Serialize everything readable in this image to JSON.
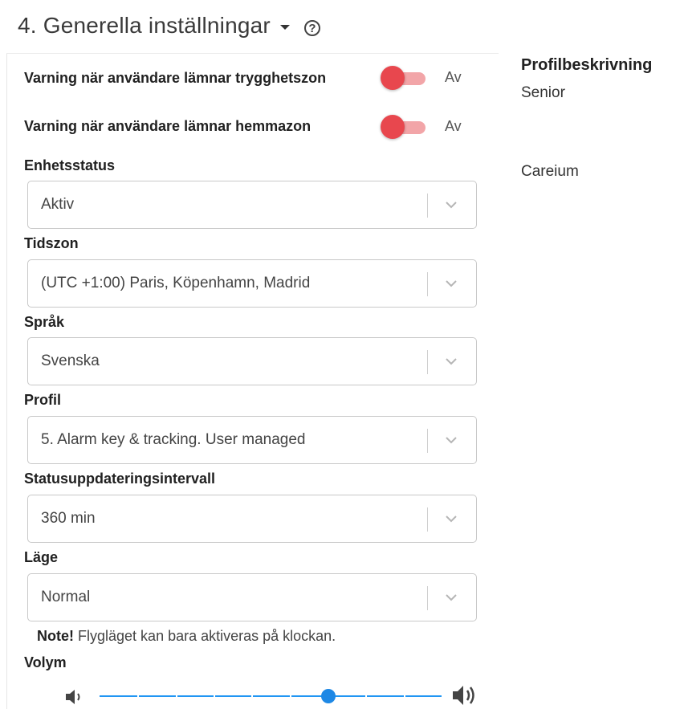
{
  "header": {
    "title": "4. Generella inställningar",
    "help_glyph": "?"
  },
  "toggles": [
    {
      "label": "Varning när användare lämnar trygghetszon",
      "state": "Av",
      "on": false
    },
    {
      "label": "Varning när användare lämnar hemmazon",
      "state": "Av",
      "on": false
    }
  ],
  "fields": {
    "device_status": {
      "label": "Enhetsstatus",
      "value": "Aktiv"
    },
    "timezone": {
      "label": "Tidszon",
      "value": "(UTC +1:00) Paris, Köpenhamn, Madrid"
    },
    "language": {
      "label": "Språk",
      "value": "Svenska"
    },
    "profile": {
      "label": "Profil",
      "value": "5. Alarm key & tracking. User managed"
    },
    "status_interval": {
      "label": "Statusuppdateringsintervall",
      "value": "360 min"
    },
    "mode": {
      "label": "Läge",
      "value": "Normal"
    }
  },
  "note": {
    "bold": "Note!",
    "text": "Flygläget kan bara aktiveras på klockan."
  },
  "volume": {
    "label": "Volym",
    "level": 0.67
  },
  "sidebar": {
    "title": "Profilbeskrivning",
    "line1": "Senior",
    "line2": "Careium"
  },
  "colors": {
    "toggle_thumb": "#e8474e",
    "toggle_track": "#f2a5a8",
    "slider": "#1e88e5"
  }
}
